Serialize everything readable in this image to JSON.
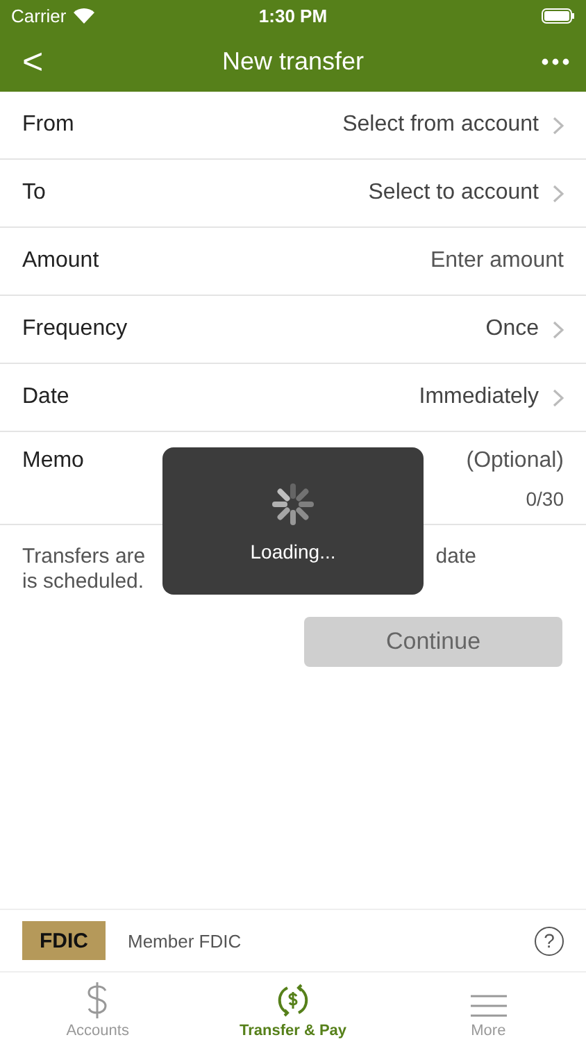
{
  "status_bar": {
    "carrier": "Carrier",
    "time": "1:30 PM"
  },
  "nav": {
    "title": "New transfer",
    "back": "<"
  },
  "form": [
    {
      "kind": "select",
      "label": "From",
      "value": "Select from account"
    },
    {
      "kind": "select",
      "label": "To",
      "value": "Select to account"
    },
    {
      "kind": "input",
      "label": "Amount",
      "placeholder": "Enter amount"
    },
    {
      "kind": "select",
      "label": "Frequency",
      "value": "Once"
    },
    {
      "kind": "select",
      "label": "Date",
      "value": "Immediately"
    },
    {
      "kind": "memo",
      "label": "Memo",
      "placeholder": "(Optional)",
      "counter": "0/30"
    }
  ],
  "note": {
    "line_1_left": "Transfers are",
    "line_1_right": "date",
    "line_2": "is scheduled."
  },
  "continue_button": {
    "label": "Continue",
    "disabled": true
  },
  "loading": {
    "text": "Loading..."
  },
  "footer": {
    "logo": "FDIC",
    "text": "Member FDIC",
    "help": "?"
  },
  "tabs": [
    {
      "label": "Accounts",
      "selected": false
    },
    {
      "label": "Transfer & Pay",
      "selected": true
    },
    {
      "label": "More",
      "selected": false
    }
  ]
}
